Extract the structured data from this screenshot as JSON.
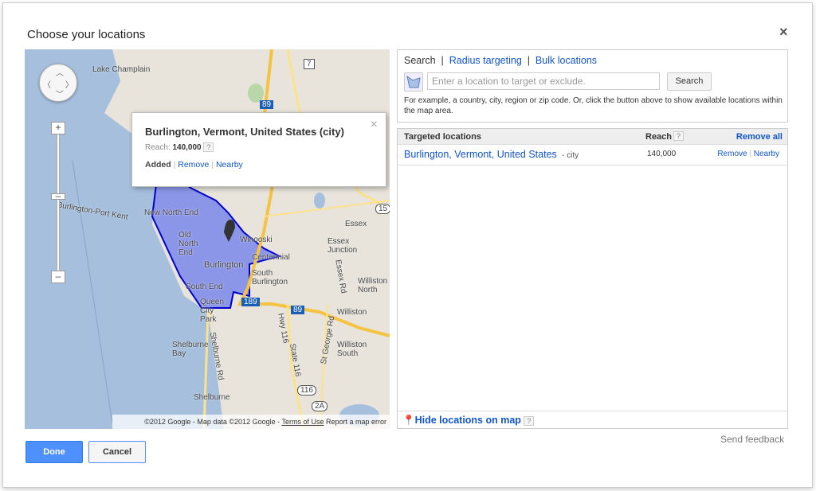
{
  "dialog": {
    "title": "Choose your locations",
    "close": "×"
  },
  "map": {
    "labels": [
      "Lake Champlain",
      "New North End",
      "Old North End",
      "Burlington",
      "Winooski",
      "Centennial",
      "South Burlington",
      "South End",
      "Queen City Park",
      "Essex",
      "Essex Junction",
      "Williston North",
      "Williston",
      "Williston South",
      "Shelburne Bay",
      "Shelburne",
      "Shelburne Rd",
      "Hwy 116",
      "State 116",
      "St George Rd",
      "Essex Rd",
      "Burlington-Port Kent"
    ],
    "shields": [
      "7",
      "89",
      "15",
      "189",
      "89",
      "116",
      "2A"
    ],
    "popup": {
      "title": "Burlington, Vermont, United States (city)",
      "reach_label": "Reach:",
      "reach": "140,000",
      "help": "?",
      "status": "Added",
      "remove": "Remove",
      "nearby": "Nearby",
      "close": "×"
    },
    "attribution": {
      "copyright": "©2012 Google - Map data ©2012 Google - ",
      "terms": "Terms of Use",
      "report": "Report a map error"
    },
    "target_color": "#5a6cf0"
  },
  "search": {
    "tabs": [
      "Search",
      "Radius targeting",
      "Bulk locations"
    ],
    "placeholder": "Enter a location to target or exclude.",
    "button": "Search",
    "hint": "For example, a country, city, region or zip code. Or, click the button above to show available locations within the map area."
  },
  "targeted": {
    "header": "Targeted locations",
    "reach_header": "Reach",
    "help": "?",
    "remove_all": "Remove all",
    "rows": [
      {
        "name": "Burlington, Vermont, United States",
        "type": "- city",
        "reach": "140,000",
        "remove": "Remove",
        "nearby": "Nearby"
      }
    ],
    "hide_link": "Hide locations on map"
  },
  "footer": {
    "feedback": "Send feedback",
    "done": "Done",
    "cancel": "Cancel"
  }
}
